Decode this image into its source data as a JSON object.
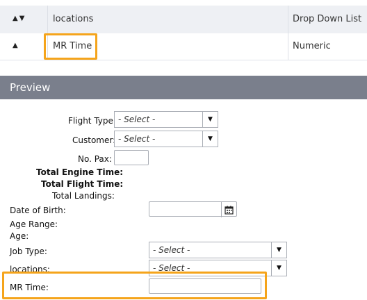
{
  "table": {
    "rows": [
      {
        "sort_icon": "▲▼",
        "name": "locations",
        "type": "Drop Down List"
      },
      {
        "sort_icon": "▲",
        "name": "MR Time",
        "type": "Numeric"
      }
    ]
  },
  "preview": {
    "title": "Preview",
    "fields": {
      "flight_type": {
        "label": "Flight Type:",
        "value": "- Select -"
      },
      "customer": {
        "label": "Customer:",
        "value": "- Select -"
      },
      "no_pax": {
        "label": "No. Pax:"
      },
      "total_engine_time": {
        "label": "Total Engine Time:"
      },
      "total_flight_time": {
        "label": "Total Flight Time:"
      },
      "total_landings": {
        "label": "Total Landings:"
      },
      "date_of_birth": {
        "label": "Date of Birth:"
      },
      "age_range": {
        "label": "Age Range:"
      },
      "age": {
        "label": "Age:"
      },
      "job_type": {
        "label": "Job Type:",
        "value": "- Select -"
      },
      "locations": {
        "label": "locations:",
        "value": "- Select -"
      },
      "mr_time": {
        "label": "MR Time:"
      }
    }
  },
  "colors": {
    "highlight": "#f5a41b",
    "preview_bar": "#7a7f8c"
  }
}
